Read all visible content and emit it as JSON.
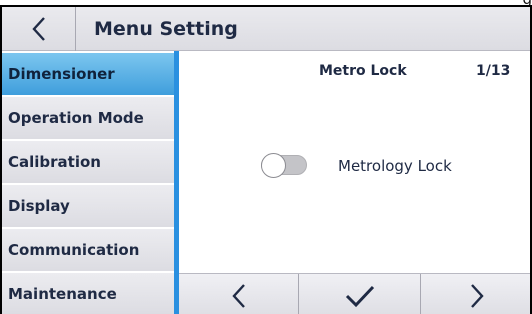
{
  "header": {
    "title": "Menu Setting",
    "title_tail": "g"
  },
  "sidebar": {
    "items": [
      {
        "label": "Dimensioner",
        "active": true
      },
      {
        "label": "Operation Mode",
        "active": false
      },
      {
        "label": "Calibration",
        "active": false
      },
      {
        "label": "Display",
        "active": false
      },
      {
        "label": "Communication",
        "active": false
      },
      {
        "label": "Maintenance",
        "active": false
      }
    ]
  },
  "page": {
    "title": "Metro Lock",
    "number": "1/13"
  },
  "settings": {
    "metrology_lock": {
      "label": "Metrology Lock",
      "enabled": false
    }
  },
  "icons": {
    "back": "chevron-left-icon",
    "prev": "chevron-left-icon",
    "confirm": "checkmark-icon",
    "next": "chevron-right-icon"
  },
  "colors": {
    "accent": "#2a90e0",
    "active_item": "#5cb3e8",
    "text": "#1f2a44"
  }
}
